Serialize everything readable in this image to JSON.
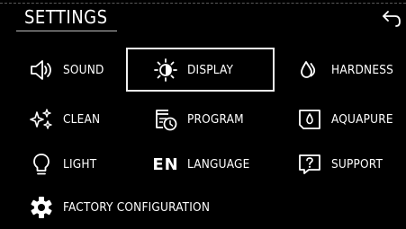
{
  "header": {
    "title": "SETTINGS",
    "back_icon": "back-arrow-icon"
  },
  "menu": {
    "sound": {
      "label": "SOUND",
      "icon": "speaker-icon"
    },
    "display": {
      "label": "DISPLAY",
      "icon": "brightness-icon",
      "selected": true
    },
    "hardness": {
      "label": "HARDNESS",
      "icon": "water-drops-icon"
    },
    "clean": {
      "label": "CLEAN",
      "icon": "sparkle-icon"
    },
    "program": {
      "label": "PROGRAM",
      "icon": "program-clock-icon"
    },
    "aquapure": {
      "label": "AQUAPURE",
      "icon": "aquapure-icon"
    },
    "light": {
      "label": "LIGHT",
      "icon": "lightbulb-icon"
    },
    "language": {
      "label": "LANGUAGE",
      "icon_text": "EN"
    },
    "support": {
      "label": "SUPPORT",
      "icon": "question-icon"
    },
    "factory": {
      "label": "FACTORY CONFIGURATION",
      "icon": "gear-icon"
    }
  },
  "colors": {
    "background": "#000000",
    "foreground": "#ffffff",
    "accent_border": "#f2f2f2"
  }
}
